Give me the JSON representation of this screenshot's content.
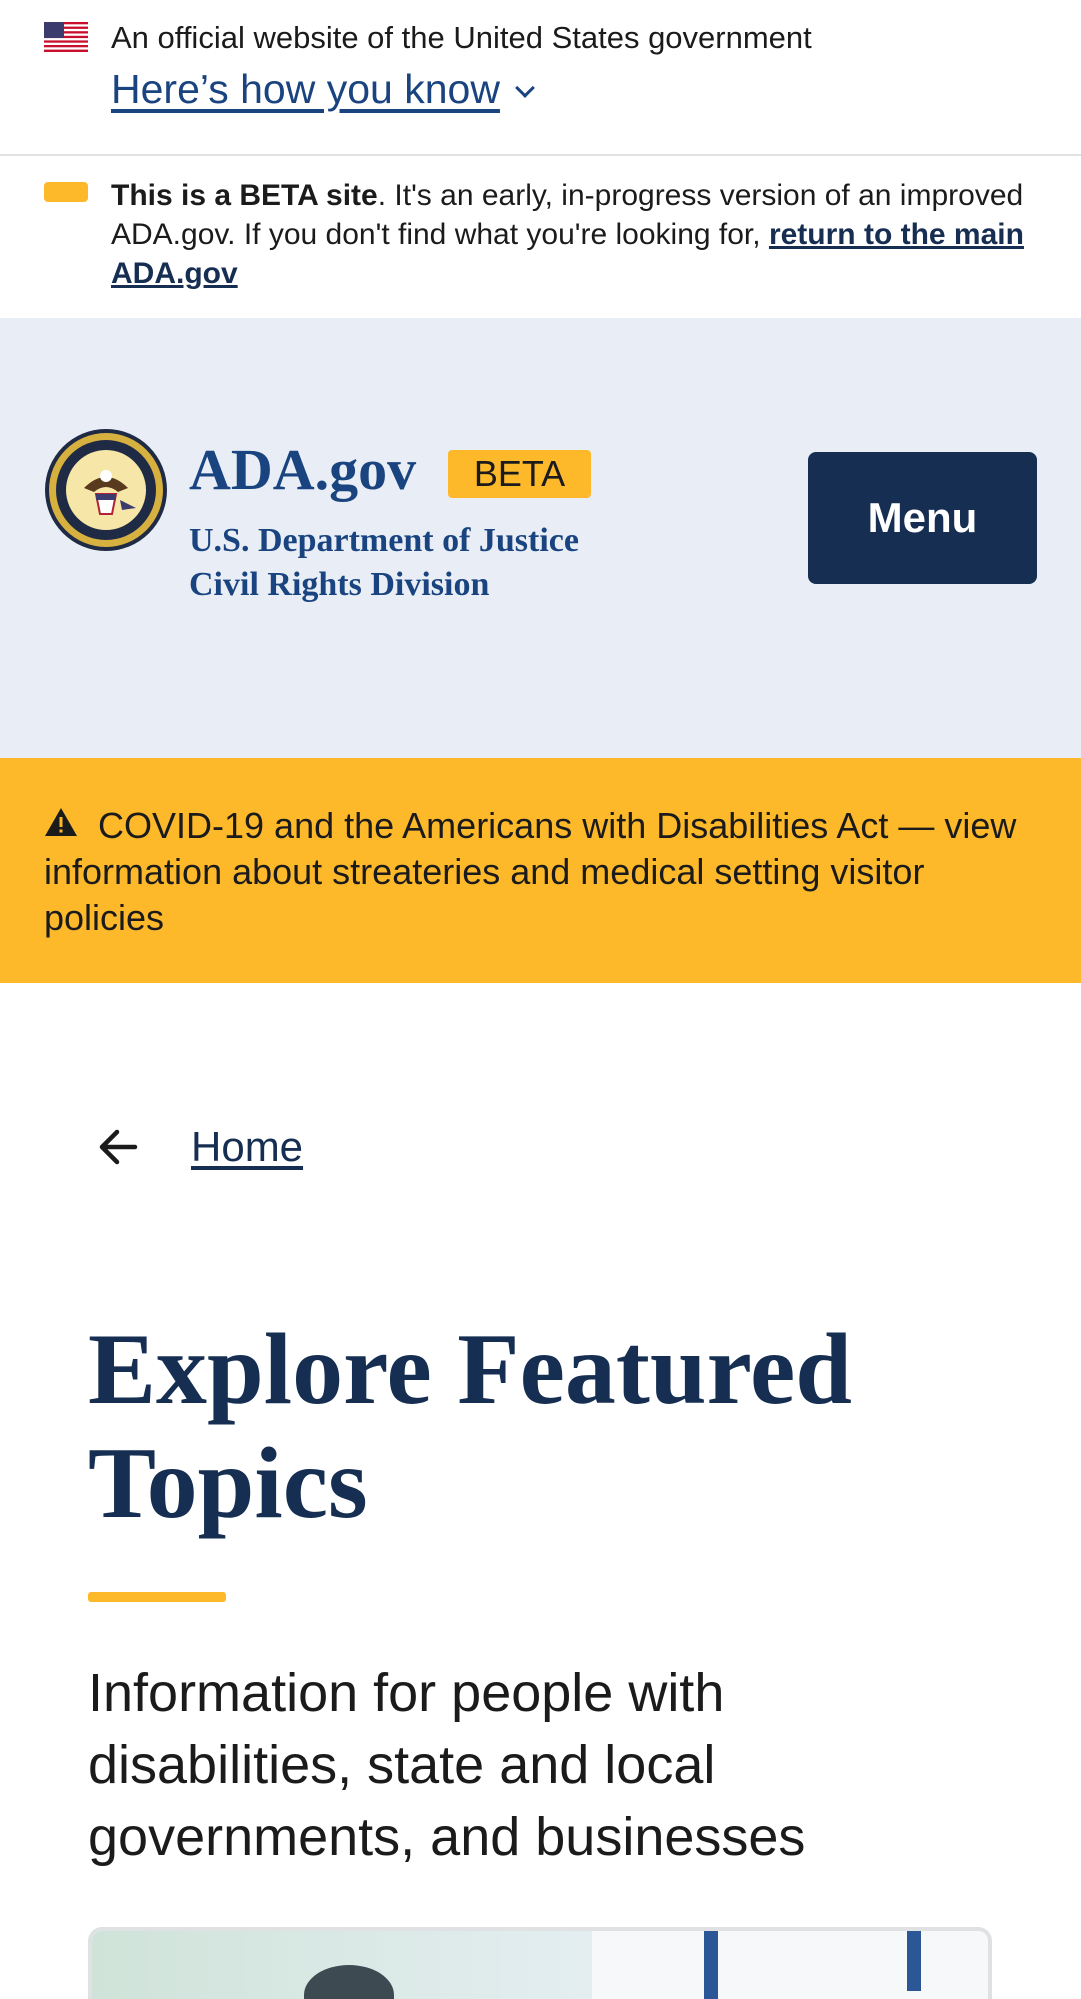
{
  "gov_banner": {
    "official_text": "An official website of the United States government",
    "how_you_know": "Here’s how you know"
  },
  "beta_notice": {
    "bold": "This is a BETA site",
    "text": ". It's an early, in-progress version of an improved ADA.gov. If you don't find what you're looking for, ",
    "link": "return to the main ADA.gov"
  },
  "header": {
    "site_title": "ADA.gov",
    "badge": "BETA",
    "dept_line_1": "U.S. Department of Justice",
    "dept_line_2": "Civil Rights Division",
    "menu_label": "Menu"
  },
  "alert": {
    "text": "COVID-19 and the Americans with Disabilities Act — view information about streateries and medical setting visitor policies"
  },
  "breadcrumb": {
    "home_label": "Home"
  },
  "main": {
    "title": "Explore Featured Topics",
    "lead": "Information for people with disabilities, state and local governments, and businesses"
  },
  "colors": {
    "primary_dark": "#162e51",
    "primary": "#1a4480",
    "accent_gold": "#fdb92a",
    "header_bg": "#e9eef6"
  }
}
